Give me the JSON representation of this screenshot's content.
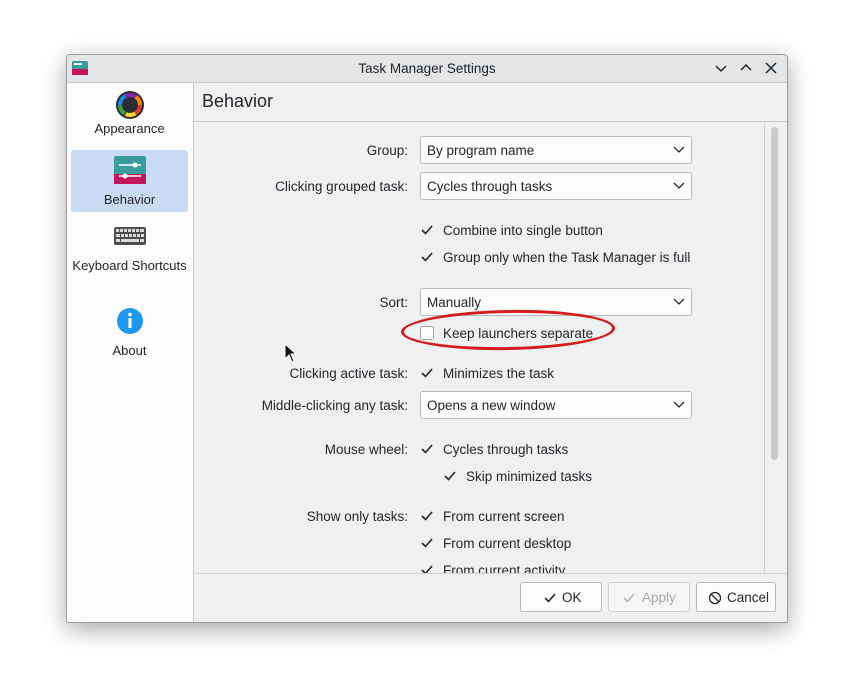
{
  "window": {
    "title": "Task Manager Settings"
  },
  "sidebar": {
    "items": [
      {
        "label": "Appearance"
      },
      {
        "label": "Behavior"
      },
      {
        "label": "Keyboard Shortcuts"
      },
      {
        "label": "About"
      }
    ]
  },
  "page": {
    "title": "Behavior",
    "group": {
      "label": "Group:",
      "value": "By program name"
    },
    "clicking_grouped": {
      "label": "Clicking grouped task:",
      "value": "Cycles through tasks"
    },
    "combine_single": {
      "label": "Combine into single button",
      "checked": true
    },
    "group_only_full": {
      "label": "Group only when the Task Manager is full",
      "checked": true
    },
    "sort": {
      "label": "Sort:",
      "value": "Manually"
    },
    "keep_launchers": {
      "label": "Keep launchers separate",
      "checked": false
    },
    "clicking_active": {
      "label": "Clicking active task:",
      "option": "Minimizes the task",
      "checked": true
    },
    "middle_click": {
      "label": "Middle-clicking any task:",
      "value": "Opens a new window"
    },
    "mouse_wheel": {
      "label": "Mouse wheel:",
      "option": "Cycles through tasks",
      "checked": true
    },
    "skip_minimized": {
      "label": "Skip minimized tasks",
      "checked": true
    },
    "show_only": {
      "label": "Show only tasks:",
      "options": [
        {
          "label": "From current screen",
          "checked": true
        },
        {
          "label": "From current desktop",
          "checked": true
        },
        {
          "label": "From current activity",
          "checked": true
        }
      ]
    }
  },
  "footer": {
    "ok": "OK",
    "apply": "Apply",
    "cancel": "Cancel"
  },
  "colors": {
    "accent": "#3daee9",
    "highlight_ring": "#d31d1d",
    "selected": "#c9daf3"
  }
}
